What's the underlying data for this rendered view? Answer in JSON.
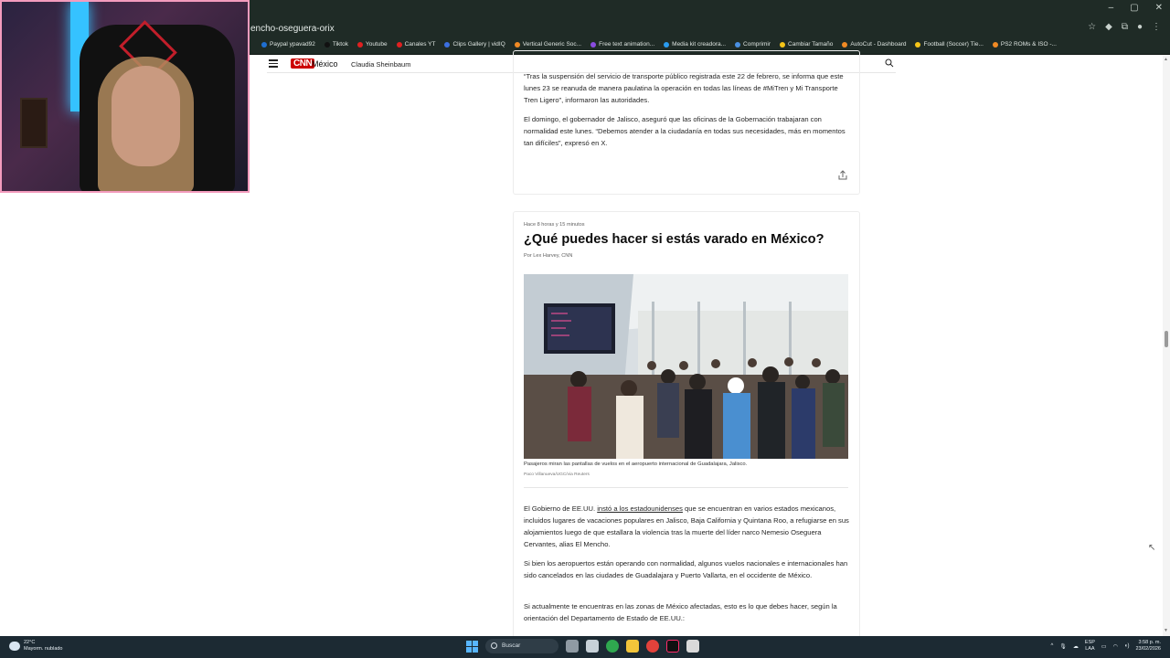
{
  "browser": {
    "url": "encho-oseguera-orix",
    "window_controls": [
      "–",
      "▢",
      "✕"
    ],
    "bookmarks": [
      {
        "label": "Paypal ypavad92",
        "color": "#1f6fd1"
      },
      {
        "label": "Tiktok",
        "color": "#111111"
      },
      {
        "label": "Youtube",
        "color": "#e02020"
      },
      {
        "label": "Canales YT",
        "color": "#e02020"
      },
      {
        "label": "Clips Gallery | vidIQ",
        "color": "#3b6fe0"
      },
      {
        "label": "Vertical Generic Soc...",
        "color": "#f08a24"
      },
      {
        "label": "Free text animation...",
        "color": "#8a4ce0"
      },
      {
        "label": "Media kit creadora...",
        "color": "#2a9cf0"
      },
      {
        "label": "Comprimir",
        "color": "#4a90e2"
      },
      {
        "label": "Cambiar Tamaño",
        "color": "#f5c518"
      },
      {
        "label": "AutoCut - Dashboard",
        "color": "#f08a24"
      },
      {
        "label": "Football (Soccer) Tie...",
        "color": "#f5c518"
      },
      {
        "label": "PS2 ROMs & ISO -...",
        "color": "#f08a24"
      }
    ]
  },
  "site": {
    "logo": "CNN",
    "edition": "México",
    "nav_link": "Claudia Sheinbaum",
    "brand_color": "#cc0000"
  },
  "article": {
    "top_paragraph_1": "“Tras la suspensión del servicio de transporte público registrada este 22 de febrero, se informa que este lunes 23 se reanuda de manera paulatina la operación en todas las líneas de #MiTren y Mi Transporte Tren Ligero”, informaron las autoridades.",
    "top_paragraph_2": "El domingo, el gobernador de Jalisco, aseguró que las oficinas de la Gobernación trabajaran con normalidad este lunes. “Debemos atender a la ciudadanía en todas sus necesidades, más en momentos tan difíciles”, expresó en X.",
    "timestamp": "Hace 8 horas y 15 minutos",
    "headline": "¿Qué puedes hacer si estás varado en México?",
    "byline": "Por Lex Harvey, CNN",
    "caption": "Pasajeros miran las pantallas de vuelos en el aeropuerto internacional de Guadalajara, Jalisco.",
    "photo_credit": "Paco Villanueva/UGC/via Reuters",
    "body_1_pre": "El Gobierno de EE.UU. ",
    "body_1_link": "instó a los estadounidenses",
    "body_1_post": " que se encuentran en varios estados mexicanos, incluidos lugares de vacaciones populares en Jalisco, Baja California y Quintana Roo, a refugiarse en sus alojamientos luego de que estallara la violencia tras la muerte del líder narco Nemesio Oseguera Cervantes, alias El Mencho.",
    "body_2": "Si bien los aeropuertos están operando con normalidad, algunos vuelos nacionales e internacionales han sido cancelados en las ciudades de Guadalajara y Puerto Vallarta, en el occidente de México.",
    "body_3": "Si actualmente te encuentras en las zonas de México afectadas, esto es lo que debes hacer, según la orientación del Departamento de Estado de EE.UU.:"
  },
  "taskbar": {
    "temperature": "22°C",
    "weather_desc": "Mayorm. nublado",
    "search_label": "Buscar",
    "lang_1": "ESP",
    "lang_2": "LAA",
    "time": "3:58 p. m.",
    "date": "23/02/2026"
  }
}
